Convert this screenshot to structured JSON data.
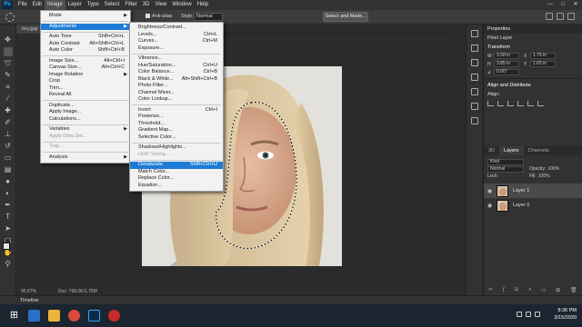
{
  "app": {
    "logo": "Ps"
  },
  "menubar": {
    "items": [
      "File",
      "Edit",
      "Image",
      "Layer",
      "Type",
      "Select",
      "Filter",
      "3D",
      "View",
      "Window",
      "Help"
    ],
    "active_index": 2,
    "window_controls": [
      "—",
      "□",
      "✕"
    ]
  },
  "options": {
    "antialias_label": "Anti-alias",
    "style_label": "Style:",
    "style_value": "Normal",
    "select_mask_label": "Select and Mask..."
  },
  "document": {
    "tab_label": "boy.jpg",
    "zoom": "95.67%",
    "doc_info": "Doc: 768.0K/1.75M"
  },
  "timeline": {
    "label": "Timeline"
  },
  "image_menu": {
    "items": [
      {
        "label": "Mode",
        "submenu": true
      },
      {
        "sep": true
      },
      {
        "label": "Adjustments",
        "submenu": true,
        "highlight": true
      },
      {
        "sep": true
      },
      {
        "label": "Auto Tone",
        "shortcut": "Shift+Ctrl+L"
      },
      {
        "label": "Auto Contrast",
        "shortcut": "Alt+Shift+Ctrl+L"
      },
      {
        "label": "Auto Color",
        "shortcut": "Shift+Ctrl+B"
      },
      {
        "sep": true
      },
      {
        "label": "Image Size...",
        "shortcut": "Alt+Ctrl+I"
      },
      {
        "label": "Canvas Size...",
        "shortcut": "Alt+Ctrl+C"
      },
      {
        "label": "Image Rotation",
        "submenu": true
      },
      {
        "label": "Crop"
      },
      {
        "label": "Trim..."
      },
      {
        "label": "Reveal All"
      },
      {
        "sep": true
      },
      {
        "label": "Duplicate..."
      },
      {
        "label": "Apply Image..."
      },
      {
        "label": "Calculations..."
      },
      {
        "sep": true
      },
      {
        "label": "Variables",
        "submenu": true
      },
      {
        "label": "Apply Data Set...",
        "disabled": true
      },
      {
        "sep": true
      },
      {
        "label": "Trap...",
        "disabled": true
      },
      {
        "sep": true
      },
      {
        "label": "Analysis",
        "submenu": true
      }
    ]
  },
  "adjustments_menu": {
    "items": [
      {
        "label": "Brightness/Contrast..."
      },
      {
        "label": "Levels...",
        "shortcut": "Ctrl+L"
      },
      {
        "label": "Curves...",
        "shortcut": "Ctrl+M"
      },
      {
        "label": "Exposure..."
      },
      {
        "sep": true
      },
      {
        "label": "Vibrance..."
      },
      {
        "label": "Hue/Saturation...",
        "shortcut": "Ctrl+U"
      },
      {
        "label": "Color Balance...",
        "shortcut": "Ctrl+B"
      },
      {
        "label": "Black & White...",
        "shortcut": "Alt+Shift+Ctrl+B"
      },
      {
        "label": "Photo Filter..."
      },
      {
        "label": "Channel Mixer..."
      },
      {
        "label": "Color Lookup..."
      },
      {
        "sep": true
      },
      {
        "label": "Invert",
        "shortcut": "Ctrl+I"
      },
      {
        "label": "Posterize..."
      },
      {
        "label": "Threshold..."
      },
      {
        "label": "Gradient Map..."
      },
      {
        "label": "Selective Color..."
      },
      {
        "sep": true
      },
      {
        "label": "Shadows/Highlights..."
      },
      {
        "label": "HDR Toning...",
        "disabled": true
      },
      {
        "sep": true
      },
      {
        "label": "Desaturate",
        "shortcut": "Shift+Ctrl+U",
        "highlight": true
      },
      {
        "label": "Match Color..."
      },
      {
        "label": "Replace Color..."
      },
      {
        "label": "Equalize..."
      }
    ]
  },
  "properties": {
    "tab": "Properties",
    "layer_type": "Pixel Layer",
    "transform_label": "Transform",
    "w_label": "W",
    "w_value": "3.58 in",
    "h_label": "H",
    "h_value": "3.85 in",
    "x_label": "X",
    "x_value": "1.76 in",
    "y_label": "Y",
    "y_value": "1.65 in",
    "angle_value": "0.00°",
    "align_label": "Align and Distribute",
    "align_sub": "Align:"
  },
  "layers": {
    "tabs": [
      "3D",
      "Layers",
      "Channels"
    ],
    "active_tab": 1,
    "kind_label": "Kind",
    "blend_mode": "Normal",
    "opacity_label": "Opacity:",
    "opacity_value": "100%",
    "lock_label": "Lock:",
    "fill_label": "Fill:",
    "fill_value": "100%",
    "list": [
      {
        "name": "Layer 1",
        "selected": true
      },
      {
        "name": "Layer 0",
        "selected": false
      }
    ],
    "footer_icons": [
      "link-icon",
      "fx-icon",
      "mask-icon",
      "adjustment-icon",
      "folder-icon",
      "new-layer-icon",
      "trash-icon"
    ]
  },
  "taskbar": {
    "time": "8:36 PM",
    "date": "3/15/2020"
  },
  "colors": {
    "menu_highlight": "#1c7bd6",
    "panel": "#323232",
    "workspace": "#2b2b2b"
  }
}
